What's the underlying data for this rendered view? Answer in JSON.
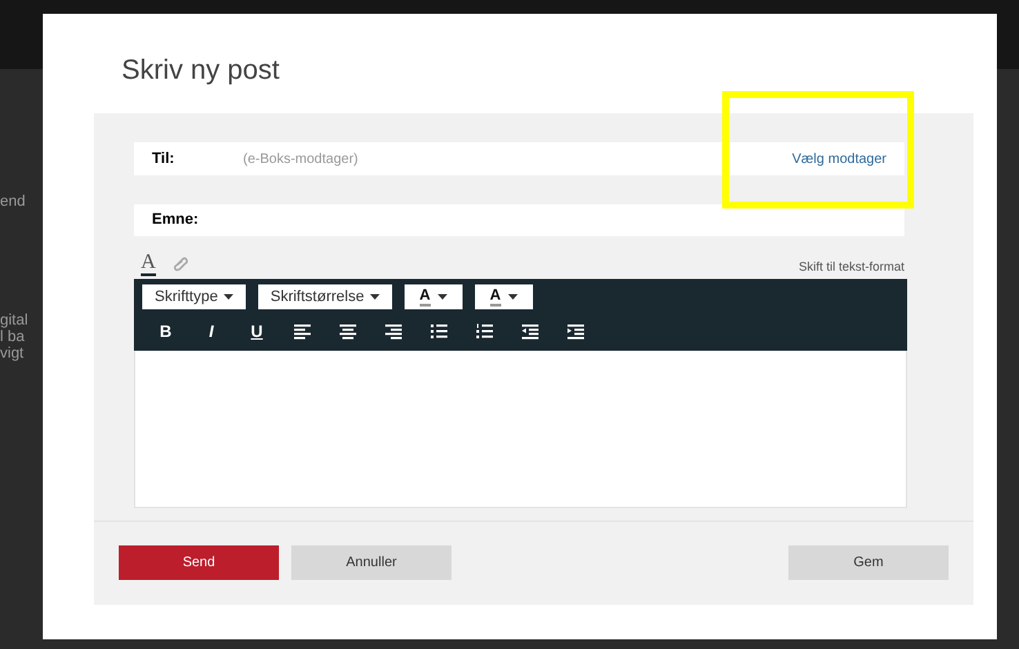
{
  "background_fragments": [
    "end",
    "gital",
    "l ba",
    "vigt"
  ],
  "dialog": {
    "title": "Skriv ny post",
    "to": {
      "label": "Til:",
      "placeholder": "(e-Boks-modtager)",
      "link": "Vælg modtager"
    },
    "subject": {
      "label": "Emne:"
    },
    "editor_tabs": [
      {
        "kind": "format",
        "label": "A",
        "selected": true
      },
      {
        "kind": "attach",
        "selected": false
      }
    ],
    "switch_link": "Skift til tekst-format",
    "dropdowns": [
      {
        "kind": "text",
        "label": "Skrifttype"
      },
      {
        "kind": "text",
        "label": "Skriftstørrelse"
      },
      {
        "kind": "color",
        "label": "A"
      },
      {
        "kind": "color",
        "label": "A"
      }
    ],
    "format_buttons": [
      {
        "kind": "bold",
        "label": "B"
      },
      {
        "kind": "italic",
        "label": "I"
      },
      {
        "kind": "underline",
        "label": "U"
      },
      {
        "kind": "align-left"
      },
      {
        "kind": "align-center"
      },
      {
        "kind": "align-right"
      },
      {
        "kind": "bullets"
      },
      {
        "kind": "numbers"
      },
      {
        "kind": "outdent"
      },
      {
        "kind": "indent"
      }
    ],
    "buttons": [
      {
        "kind": "primary",
        "label": "Send"
      },
      {
        "kind": "secondary",
        "label": "Annuller"
      },
      {
        "kind": "spacer"
      },
      {
        "kind": "secondary",
        "label": "Gem"
      }
    ]
  }
}
